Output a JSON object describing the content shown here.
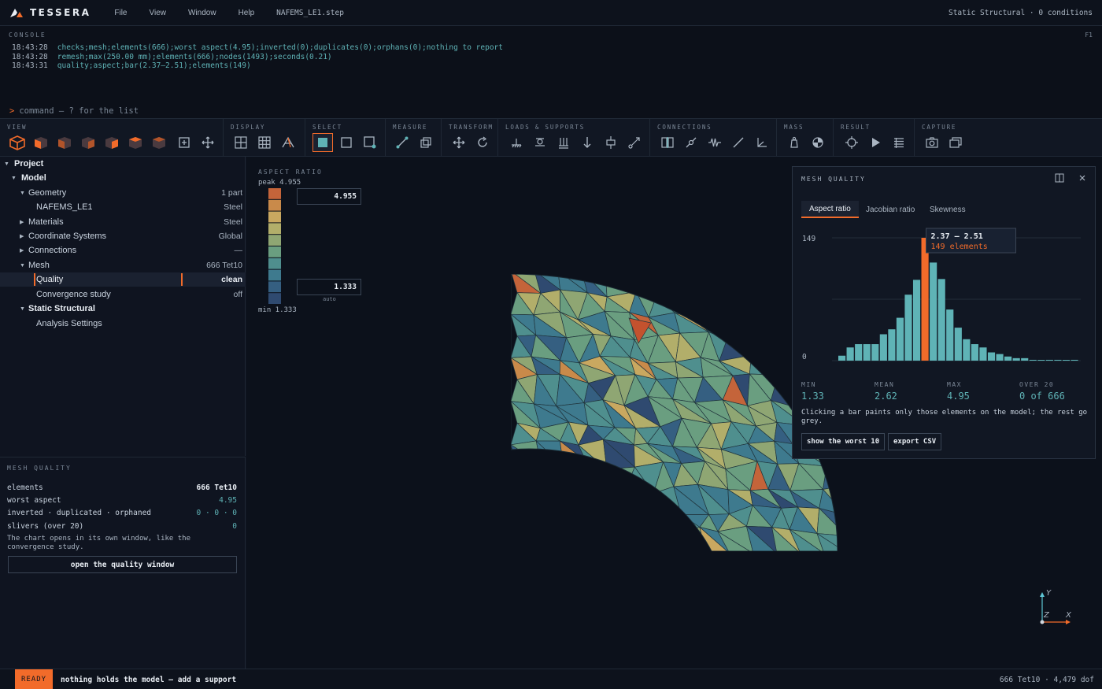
{
  "app": {
    "name": "TESSERA",
    "file": "NAFEMS_LE1.step",
    "analysis_status": "Static Structural · 0 conditions"
  },
  "menu": [
    "File",
    "View",
    "Window",
    "Help"
  ],
  "console": {
    "title": "CONSOLE",
    "key": "F1",
    "lines": [
      {
        "time": "18:43:28",
        "msg": "checks;mesh;elements(666);worst aspect(4.95);inverted(0);duplicates(0);orphans(0);nothing to report"
      },
      {
        "time": "18:43:28",
        "msg": "remesh;max(250.00 mm);elements(666);nodes(1493);seconds(0.21)"
      },
      {
        "time": "18:43:31",
        "msg": "quality;aspect;bar(2.37–2.51);elements(149)"
      }
    ],
    "prompt": ">",
    "placeholder": "command  —  ? for the list"
  },
  "toolbar": {
    "groups": [
      "VIEW",
      "DISPLAY",
      "SELECT",
      "MEASURE",
      "TRANSFORM",
      "LOADS & SUPPORTS",
      "CONNECTIONS",
      "MASS",
      "RESULT",
      "CAPTURE"
    ]
  },
  "tree": {
    "rows": [
      {
        "label": "Project",
        "value": ""
      },
      {
        "label": "Model",
        "value": ""
      },
      {
        "label": "Geometry",
        "value": "1 part"
      },
      {
        "label": "NAFEMS_LE1",
        "value": "Steel"
      },
      {
        "label": "Materials",
        "value": "Steel"
      },
      {
        "label": "Coordinate Systems",
        "value": "Global"
      },
      {
        "label": "Connections",
        "value": "—"
      },
      {
        "label": "Mesh",
        "value": "666 Tet10"
      },
      {
        "label": "Quality",
        "value": "clean"
      },
      {
        "label": "Convergence study",
        "value": "off"
      },
      {
        "label": "Static Structural",
        "value": ""
      },
      {
        "label": "Analysis Settings",
        "value": ""
      }
    ]
  },
  "mesh_quality_panel": {
    "title": "MESH QUALITY",
    "rows": [
      {
        "label": "elements",
        "value": "666 Tet10"
      },
      {
        "label": "worst aspect",
        "value": "4.95"
      },
      {
        "label": "inverted · duplicated · orphaned",
        "value": "0 · 0 · 0"
      },
      {
        "label": "slivers (over 20)",
        "value": "0"
      }
    ],
    "note": "The chart opens in its own window, like the convergence study.",
    "button": "open the quality window"
  },
  "legend": {
    "title": "ASPECT RATIO",
    "peak": "peak 4.955",
    "max_value": "4.955",
    "min_value": "1.333",
    "auto": "auto",
    "min": "min 1.333",
    "colors": [
      "#c4643a",
      "#c98a4a",
      "#c9a860",
      "#b2ae6a",
      "#8fa673",
      "#6a9e80",
      "#4f8f8e",
      "#3e7a8e",
      "#355f81",
      "#2f4a70"
    ]
  },
  "quality_window": {
    "title": "MESH QUALITY",
    "tabs": [
      "Aspect ratio",
      "Jacobian ratio",
      "Skewness"
    ],
    "stats": [
      {
        "label": "MIN",
        "value": "1.33"
      },
      {
        "label": "MEAN",
        "value": "2.62"
      },
      {
        "label": "MAX",
        "value": "4.95"
      },
      {
        "label": "OVER 20",
        "value": "0 of 666"
      }
    ],
    "note": "Clicking a bar paints only those elements on the model; the rest go grey.",
    "buttons": [
      "show the worst 10",
      "export CSV"
    ]
  },
  "chart_data": {
    "type": "bar",
    "xlim": [
      1,
      4.95
    ],
    "ylim": [
      0,
      149
    ],
    "x_ticks": [
      "1",
      "4.95"
    ],
    "y_ticks": [
      "149",
      "0"
    ],
    "values": [
      6,
      16,
      20,
      20,
      20,
      32,
      38,
      52,
      80,
      98,
      149,
      119,
      99,
      62,
      40,
      26,
      20,
      16,
      10,
      8,
      5,
      3,
      3,
      1,
      0,
      1,
      1,
      0,
      1
    ],
    "highlight_index": 10,
    "tooltip": {
      "range": "2.37 – 2.51",
      "count": "149 elements"
    },
    "bar_color": "#5fb3b6",
    "highlight_color": "#f26b2a"
  },
  "status": {
    "badge": "READY",
    "message": "nothing holds the model — add a support",
    "right": "666 Tet10 · 4,479 dof"
  },
  "axes": {
    "y": "Y",
    "x": "X",
    "z": "Z"
  }
}
